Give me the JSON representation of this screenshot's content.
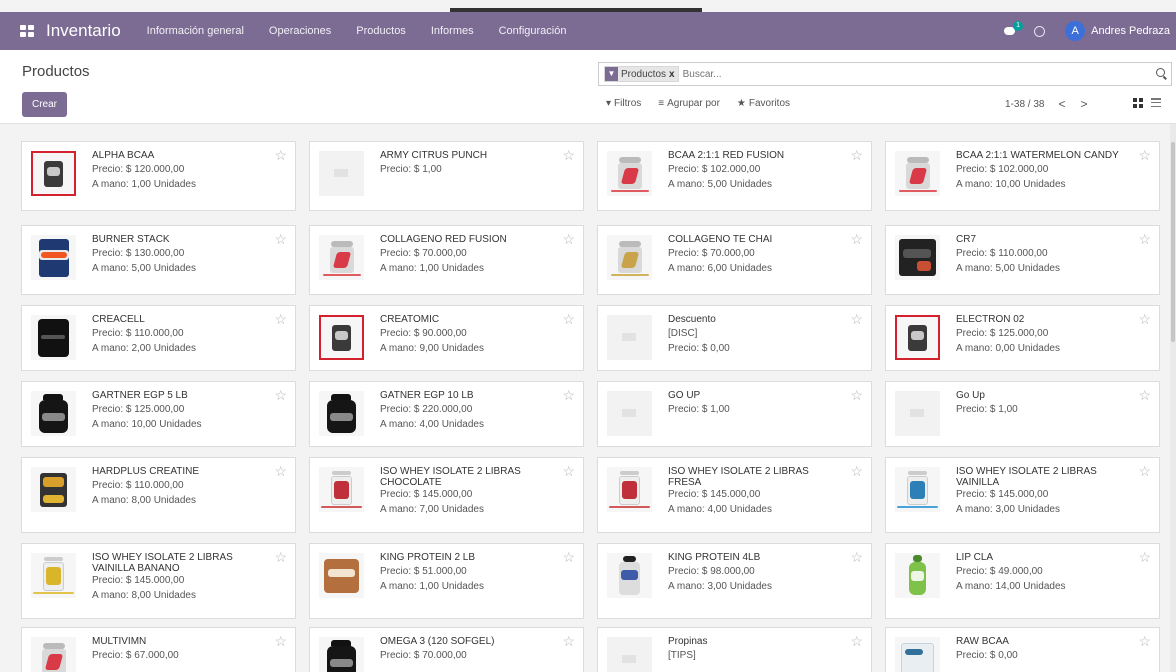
{
  "app": {
    "title": "Inventario",
    "menu": [
      "Información general",
      "Operaciones",
      "Productos",
      "Informes",
      "Configuración"
    ],
    "notification_count": "1",
    "user_initial": "A",
    "user_name": "Andres Pedraza"
  },
  "control": {
    "page_title": "Productos",
    "create_label": "Crear",
    "facet_label": "Productos",
    "facet_close": "x",
    "search_placeholder": "Buscar...",
    "filters_label": "Filtros",
    "groupby_label": "Agrupar por",
    "favorites_label": "Favoritos",
    "pager_value": "1-38 / 38",
    "pager_prev": "<",
    "pager_next": ">"
  },
  "products": [
    {
      "name": "ALPHA BCAA",
      "lines": [
        "Precio: $ 120.000,00",
        "A mano: 1,00 Unidades"
      ],
      "image": "dark-tub-red-frame"
    },
    {
      "name": "ARMY CITRUS PUNCH",
      "lines": [
        "Precio: $ 1,00"
      ],
      "image": "placeholder"
    },
    {
      "name": "BCAA 2:1:1 RED FUSION",
      "lines": [
        "Precio: $ 102.000,00",
        "A mano: 5,00 Unidades"
      ],
      "image": "red-fusion-tub"
    },
    {
      "name": "BCAA 2:1:1 WATERMELON CANDY",
      "lines": [
        "Precio: $ 102.000,00",
        "A mano: 10,00 Unidades"
      ],
      "image": "red-fusion-tub"
    },
    {
      "name": "BURNER STACK",
      "lines": [
        "Precio: $ 130.000,00",
        "A mano: 5,00 Unidades"
      ],
      "image": "burner-tub"
    },
    {
      "name": "COLLAGENO RED FUSION",
      "lines": [
        "Precio: $ 70.000,00",
        "A mano: 1,00 Unidades"
      ],
      "image": "red-fusion-tub"
    },
    {
      "name": "COLLAGENO TE CHAI",
      "lines": [
        "Precio: $ 70.000,00",
        "A mano: 6,00 Unidades"
      ],
      "image": "tea-tub"
    },
    {
      "name": "CR7",
      "lines": [
        "Precio: $ 110.000,00",
        "A mano: 5,00 Unidades"
      ],
      "image": "dark-tub"
    },
    {
      "name": "CREACELL",
      "lines": [
        "Precio: $ 110.000,00",
        "A mano: 2,00 Unidades"
      ],
      "image": "black-tub"
    },
    {
      "name": "CREATOMIC",
      "lines": [
        "Precio: $ 90.000,00",
        "A mano: 9,00 Unidades"
      ],
      "image": "dark-tub-red-frame"
    },
    {
      "name": "Descuento",
      "lines": [
        "[DISC]",
        "Precio: $ 0,00"
      ],
      "image": "placeholder"
    },
    {
      "name": "ELECTRON 02",
      "lines": [
        "Precio: $ 125.000,00",
        "A mano: 0,00 Unidades"
      ],
      "image": "dark-tub-red-frame"
    },
    {
      "name": "GARTNER EGP 5 LB",
      "lines": [
        "Precio: $ 125.000,00",
        "A mano: 10,00 Unidades"
      ],
      "image": "black-bottle"
    },
    {
      "name": "GATNER EGP 10 LB",
      "lines": [
        "Precio: $ 220.000,00",
        "A mano: 4,00 Unidades"
      ],
      "image": "black-bottle"
    },
    {
      "name": "GO UP",
      "lines": [
        "Precio: $ 1,00"
      ],
      "image": "placeholder"
    },
    {
      "name": "Go Up",
      "lines": [
        "Precio: $ 1,00"
      ],
      "image": "placeholder"
    },
    {
      "name": "HARDPLUS CREATINE",
      "lines": [
        "Precio: $ 110.000,00",
        "A mano: 8,00 Unidades"
      ],
      "image": "gold-box"
    },
    {
      "name": "ISO WHEY ISOLATE 2 LIBRAS CHOCOLATE",
      "lines": [
        "Precio: $ 145.000,00",
        "A mano: 7,00 Unidades"
      ],
      "image": "red-tub"
    },
    {
      "name": "ISO WHEY ISOLATE 2 LIBRAS FRESA",
      "lines": [
        "Precio: $ 145.000,00",
        "A mano: 4,00 Unidades"
      ],
      "image": "red-tub"
    },
    {
      "name": "ISO WHEY ISOLATE 2 LIBRAS VAINILLA",
      "lines": [
        "Precio: $ 145.000,00",
        "A mano: 3,00 Unidades"
      ],
      "image": "blue-tub"
    },
    {
      "name": "ISO WHEY ISOLATE 2 LIBRAS VAINILLA BANANO",
      "lines": [
        "Precio: $ 145.000,00",
        "A mano: 8,00 Unidades"
      ],
      "image": "yellow-tub"
    },
    {
      "name": "KING PROTEIN 2 LB",
      "lines": [
        "Precio: $ 51.000,00",
        "A mano: 1,00 Unidades"
      ],
      "image": "bag"
    },
    {
      "name": "KING PROTEIN 4LB",
      "lines": [
        "Precio: $ 98.000,00",
        "A mano: 3,00 Unidades"
      ],
      "image": "white-bottle"
    },
    {
      "name": "LIP CLA",
      "lines": [
        "Precio: $ 49.000,00",
        "A mano: 14,00 Unidades"
      ],
      "image": "green-bottle"
    },
    {
      "name": "MULTIVIMN",
      "lines": [
        "Precio: $ 67.000,00"
      ],
      "image": "red-fusion-tub"
    },
    {
      "name": "OMEGA 3 (120 SOFGEL)",
      "lines": [
        "Precio: $ 70.000,00"
      ],
      "image": "black-bottle"
    },
    {
      "name": "Propinas",
      "lines": [
        "[TIPS]"
      ],
      "image": "placeholder"
    },
    {
      "name": "RAW BCAA",
      "lines": [
        "Precio: $ 0,00"
      ],
      "image": "white-box"
    }
  ],
  "colors": {
    "brand": "#7c6c94",
    "badge": "#00a09d",
    "avatar": "#3d6fd8",
    "frame": "#d4212e"
  },
  "icons": [
    "apps-icon",
    "chat-icon",
    "clock-icon",
    "filter-icon",
    "search-icon",
    "star-icon",
    "kanban-view-icon",
    "list-view-icon"
  ]
}
